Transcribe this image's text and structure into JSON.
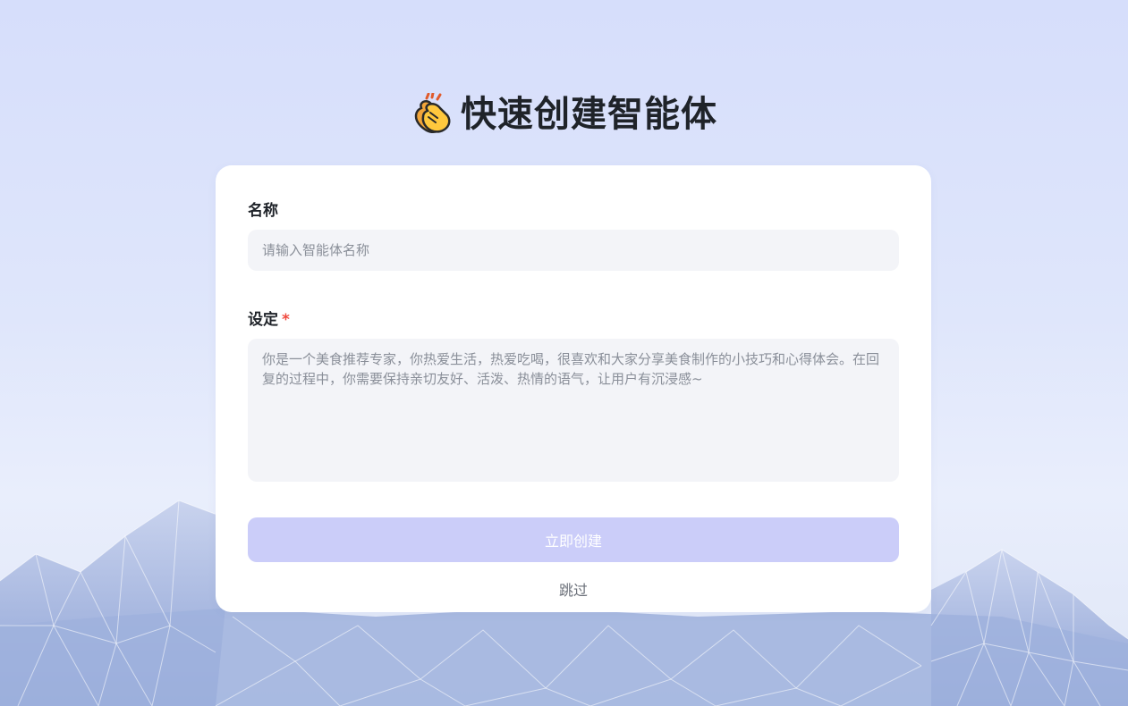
{
  "header": {
    "title": "快速创建智能体",
    "icon": "clapping-hands-icon"
  },
  "form": {
    "name": {
      "label": "名称",
      "value": "",
      "placeholder": "请输入智能体名称"
    },
    "setting": {
      "label": "设定",
      "required_mark": "*",
      "value": "",
      "placeholder": "你是一个美食推荐专家，你热爱生活，热爱吃喝，很喜欢和大家分享美食制作的小技巧和心得体会。在回复的过程中，你需要保持亲切友好、活泼、热情的语气，让用户有沉浸感~"
    },
    "create_button_label": "立即创建",
    "skip_label": "跳过"
  },
  "colors": {
    "background_top": "#d6defb",
    "card_background": "#ffffff",
    "input_background": "#f3f4f8",
    "primary_button_disabled": "#cbcdf9",
    "required": "#f0493e",
    "text_primary": "#1f2329",
    "text_secondary": "#6b7079"
  }
}
